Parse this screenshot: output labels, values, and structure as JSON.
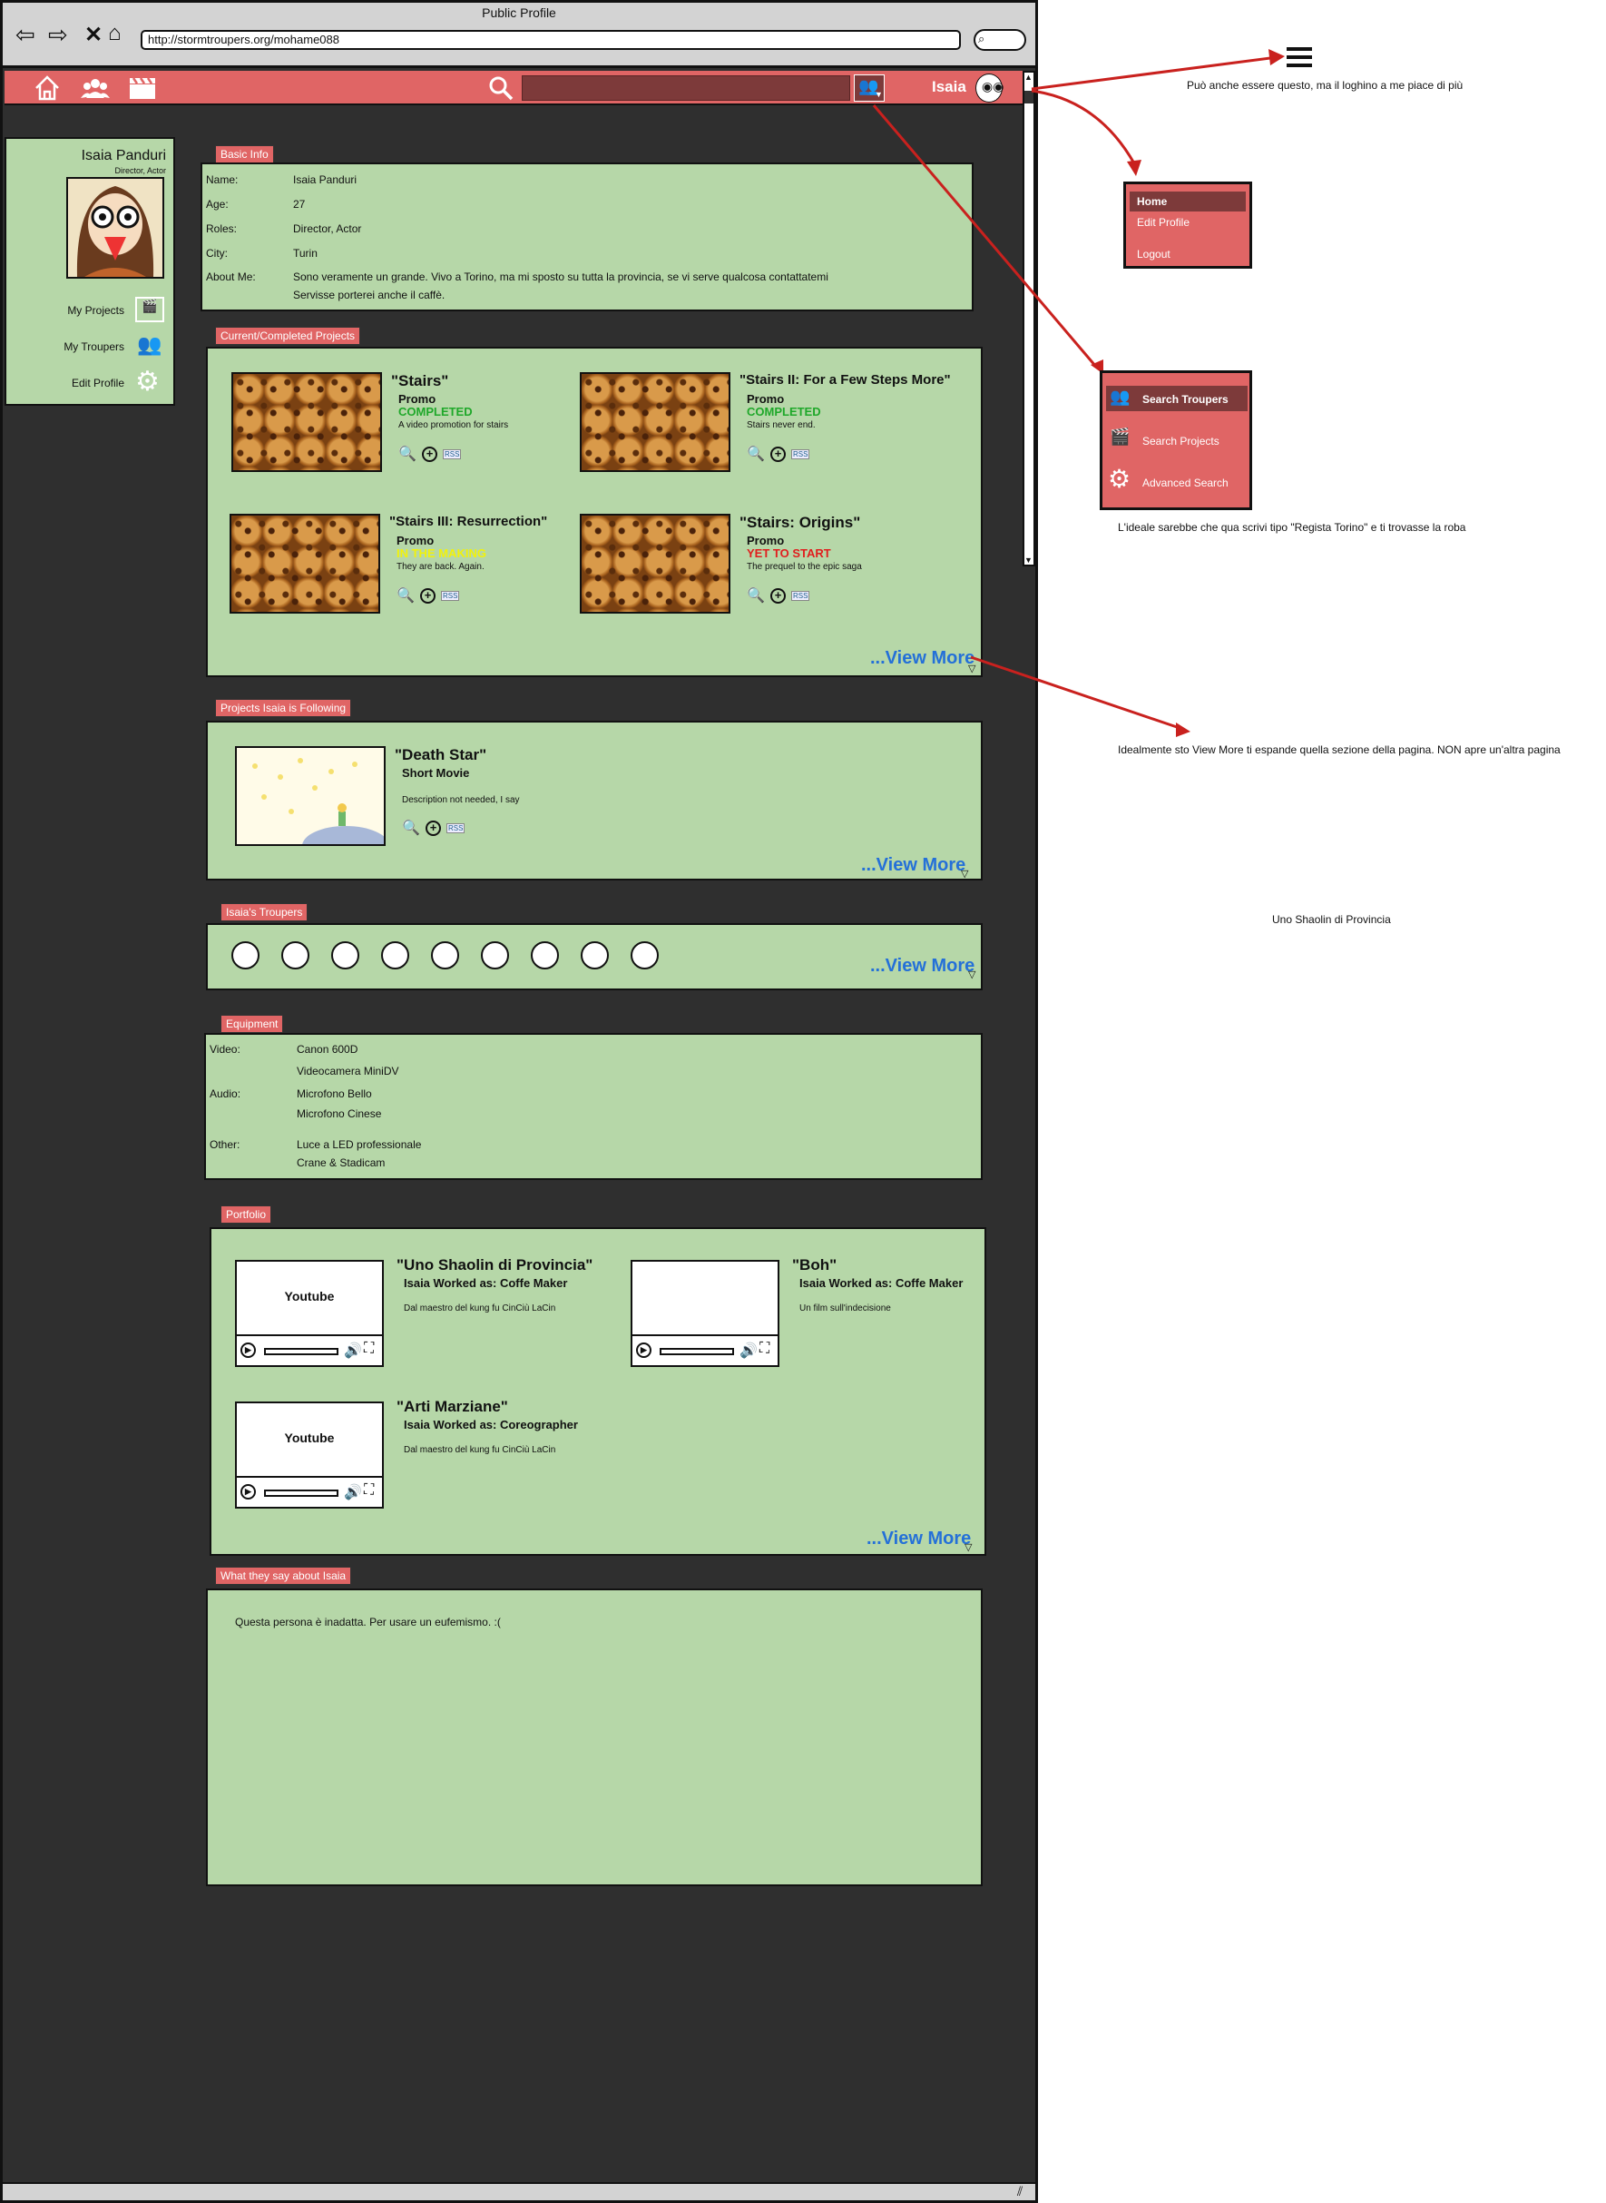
{
  "browser": {
    "title": "Public Profile",
    "url": "http://stormtroupers.org/mohame088"
  },
  "nav": {
    "user": "Isaia"
  },
  "sidebar": {
    "name": "Isaia Panduri",
    "roles": "Director,  Actor",
    "links": [
      "My Projects",
      "My Troupers",
      "Edit Profile"
    ]
  },
  "basic_info": {
    "title": "Basic Info",
    "fields": [
      {
        "label": "Name:",
        "value": "Isaia Panduri"
      },
      {
        "label": "Age:",
        "value": "27"
      },
      {
        "label": "Roles:",
        "value": "Director, Actor"
      },
      {
        "label": "City:",
        "value": "Turin"
      },
      {
        "label": "About Me:",
        "value": "Sono veramente un grande. Vivo a Torino, ma mi sposto su tutta la provincia, se vi serve qualcosa contattatemi",
        "value2": "Servisse porterei anche il caffè."
      }
    ]
  },
  "projects": {
    "title": "Current/Completed Projects",
    "items": [
      {
        "title": "\"Stairs\"",
        "type": "Promo",
        "status": "COMPLETED",
        "status_color": "#1fa82a",
        "desc": "A video promotion for stairs"
      },
      {
        "title": "\"Stairs II: For a Few Steps More\"",
        "type": "Promo",
        "status": "COMPLETED",
        "status_color": "#1fa82a",
        "desc": "Stairs never end."
      },
      {
        "title": "\"Stairs III: Resurrection\"",
        "type": "Promo",
        "status": "IN THE MAKING",
        "status_color": "#f2f20a",
        "desc": "They are back. Again."
      },
      {
        "title": "\"Stairs: Origins\"",
        "type": "Promo",
        "status": "YET TO START",
        "status_color": "#e11d1d",
        "desc": "The prequel to the epic saga"
      }
    ],
    "view_more": "...View More"
  },
  "following": {
    "title": "Projects Isaia is Following",
    "item": {
      "title": "\"Death Star\"",
      "type": "Short Movie",
      "desc": "Description not needed, I say"
    },
    "view_more": "...View More"
  },
  "troupers": {
    "title": "Isaia's Troupers",
    "count": 9,
    "view_more": "...View More"
  },
  "equipment": {
    "title": "Equipment",
    "rows": [
      {
        "label": "Video:",
        "items": [
          "Canon 600D",
          "Videocamera MiniDV"
        ]
      },
      {
        "label": "Audio:",
        "items": [
          "Microfono Bello",
          "Microfono Cinese"
        ]
      },
      {
        "label": "Other:",
        "items": [
          "Luce a LED professionale",
          "Crane & Stadicam"
        ]
      }
    ]
  },
  "portfolio": {
    "title": "Portfolio",
    "items": [
      {
        "title": "\"Uno Shaolin di Provincia\"",
        "role": "Isaia Worked as: Coffe Maker",
        "desc": "Dal maestro del kung fu CinCiù LaCin",
        "player": "Youtube"
      },
      {
        "title": "\"Boh\"",
        "role": "Isaia Worked as: Coffe Maker",
        "desc": "Un film sull'indecisione",
        "player": ""
      },
      {
        "title": "\"Arti Marziane\"",
        "role": "Isaia Worked as: Coreographer",
        "desc": "Dal maestro del kung fu CinCiù LaCin",
        "player": "Youtube"
      }
    ],
    "view_more": "...View More"
  },
  "reviews": {
    "title": "What they say about Isaia",
    "text": "Questa persona è inadatta. Per usare un eufemismo. :("
  },
  "annotations": {
    "hamburger_note": "Può anche essere questo, ma il loghino a me piace di più",
    "user_menu": [
      "Home",
      "Edit Profile",
      "Logout"
    ],
    "search_menu": [
      "Search Troupers",
      "Search Projects",
      "Advanced Search"
    ],
    "search_note": "L'ideale sarebbe che qua scrivi tipo \"Regista Torino\" e ti trovasse la roba",
    "view_more_note": "Idealmente sto View More ti espande quella sezione della pagina. NON apre un'altra pagina",
    "loose_note": "Uno Shaolin di Provincia"
  },
  "colors": {
    "accent": "#e06565",
    "panel": "#b6d7a8",
    "background": "#2f2f2f",
    "link": "#2470d8"
  }
}
